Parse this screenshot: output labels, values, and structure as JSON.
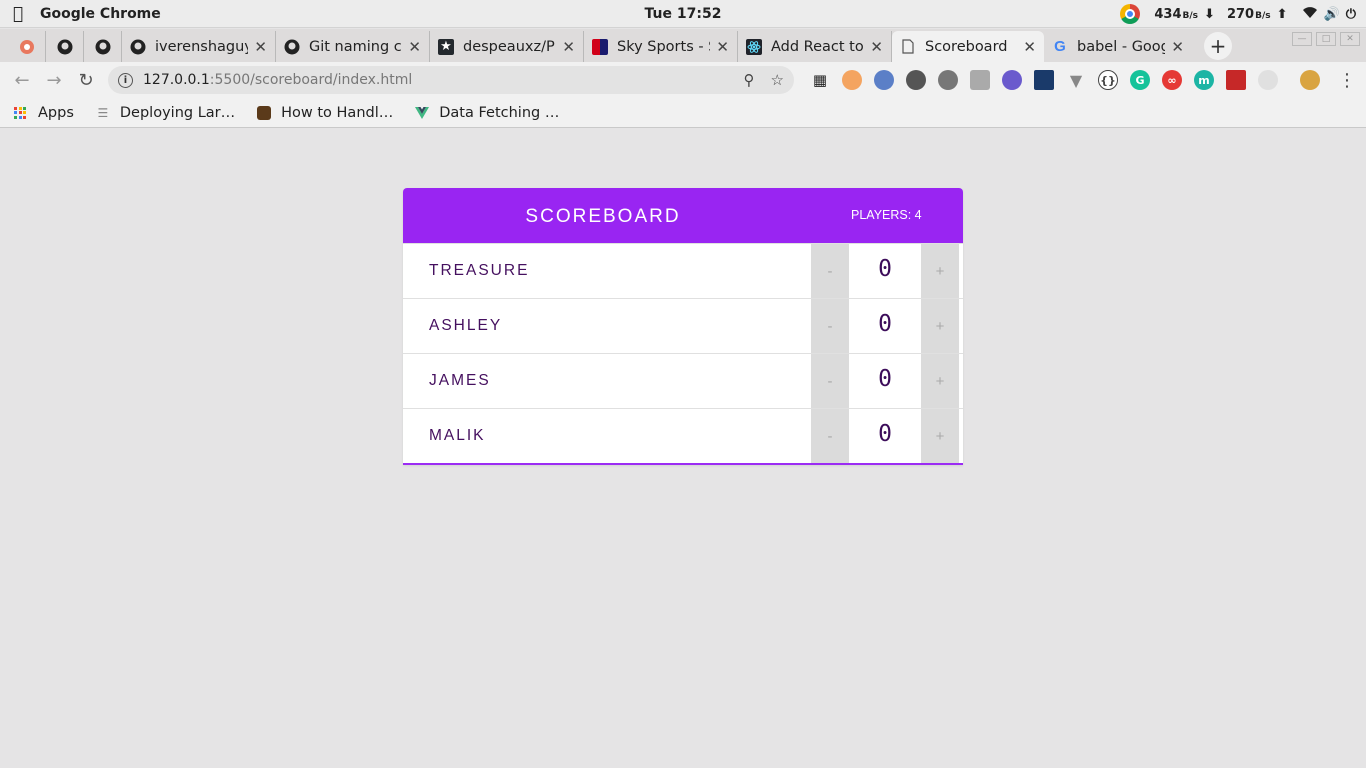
{
  "os": {
    "app_name": "Google Chrome",
    "clock": "Tue 17:52",
    "net_down": "434",
    "net_down_unit": "B/s",
    "net_up": "270",
    "net_up_unit": "B/s"
  },
  "tabs": [
    {
      "title": "",
      "icon": "app-icon",
      "pinned": true
    },
    {
      "title": "",
      "icon": "github-icon",
      "pinned": true
    },
    {
      "title": "",
      "icon": "github-icon",
      "pinned": true
    },
    {
      "title": "iverenshaguy",
      "icon": "github-icon"
    },
    {
      "title": "Git naming co",
      "icon": "github-icon"
    },
    {
      "title": "despeauxz/P",
      "icon": "star-icon"
    },
    {
      "title": "Sky Sports - S",
      "icon": "sky-sports-icon"
    },
    {
      "title": "Add React to",
      "icon": "react-icon"
    },
    {
      "title": "Scoreboard",
      "icon": "page-icon",
      "active": true
    },
    {
      "title": "babel - Googl",
      "icon": "google-icon"
    }
  ],
  "address_bar": {
    "host": "127.0.0.1",
    "path": ":5500/scoreboard/index.html"
  },
  "bookmarks": [
    {
      "label": "Apps",
      "icon": "apps-grid-icon"
    },
    {
      "label": "Deploying Lar…",
      "icon": "bookmark-lines-icon"
    },
    {
      "label": "How to Handl…",
      "icon": "hacker-avatar-icon"
    },
    {
      "label": "Data Fetching …",
      "icon": "vue-icon"
    }
  ],
  "scoreboard": {
    "title": "SCOREBOARD",
    "players_label": "PLAYERS: 4",
    "decrement_label": "-",
    "increment_label": "+",
    "players": [
      {
        "name": "TREASURE",
        "score": "0"
      },
      {
        "name": "ASHLEY",
        "score": "0"
      },
      {
        "name": "JAMES",
        "score": "0"
      },
      {
        "name": "MALIK",
        "score": "0"
      }
    ]
  },
  "colors": {
    "header": "#9925f2",
    "player_text": "#45105f",
    "page_bg": "#e5e4e5"
  }
}
